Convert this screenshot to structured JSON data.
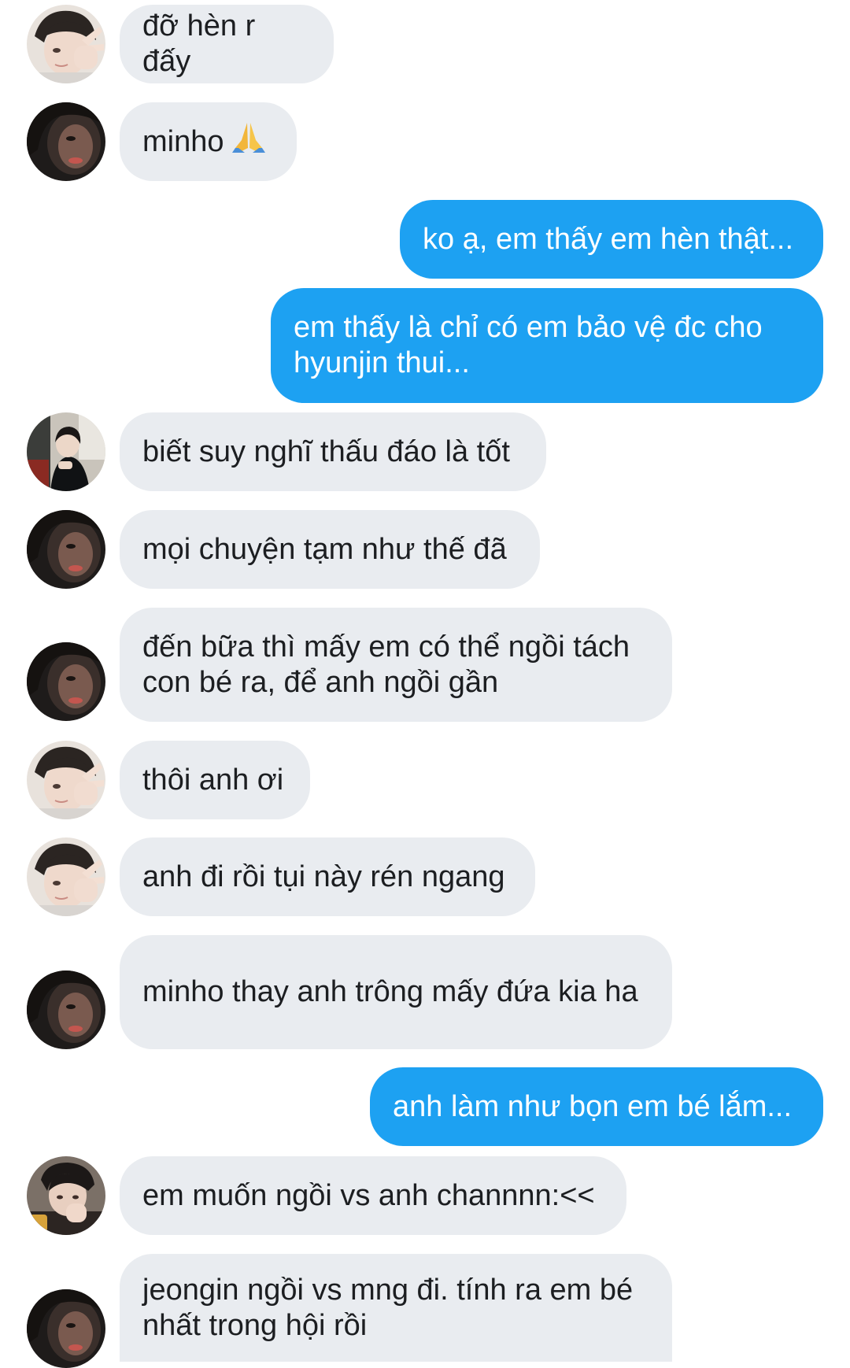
{
  "conversation": {
    "messages": [
      {
        "sender": "avatar-a",
        "direction": "incoming",
        "text": "đỡ hèn r đấy"
      },
      {
        "sender": "avatar-b",
        "direction": "incoming",
        "text": "minho",
        "emoji": "folded-hands-icon"
      },
      {
        "direction": "outgoing",
        "text": "ko ạ, em thấy em hèn thật..."
      },
      {
        "direction": "outgoing",
        "text": "em thấy là chỉ có em bảo vệ đc cho hyunjin thui..."
      },
      {
        "sender": "avatar-c",
        "direction": "incoming",
        "text": "biết suy nghĩ thấu đáo là tốt"
      },
      {
        "sender": "avatar-b",
        "direction": "incoming",
        "text": "mọi chuyện tạm như thế đã"
      },
      {
        "sender": "avatar-b",
        "direction": "incoming",
        "text": "đến bữa thì mấy em có thể ngồi tách con bé ra, để anh ngồi gần"
      },
      {
        "sender": "avatar-a",
        "direction": "incoming",
        "text": "thôi anh ơi"
      },
      {
        "sender": "avatar-a",
        "direction": "incoming",
        "text": "anh đi rồi tụi này rén ngang"
      },
      {
        "sender": "avatar-b",
        "direction": "incoming",
        "text": "minho thay anh trông mấy đứa kia ha"
      },
      {
        "direction": "outgoing",
        "text": "anh làm như bọn em bé lắm..."
      },
      {
        "sender": "avatar-d",
        "direction": "incoming",
        "text": "em muốn ngồi vs anh channnn:<<"
      },
      {
        "sender": "avatar-b",
        "direction": "incoming",
        "text": "jeongin ngồi vs mng đi. tính ra em bé nhất trong hội rồi"
      }
    ]
  },
  "colors": {
    "incoming_bubble": "#e9ecf0",
    "outgoing_bubble": "#1da1f2",
    "incoming_text": "#1c1e21",
    "outgoing_text": "#ffffff"
  }
}
